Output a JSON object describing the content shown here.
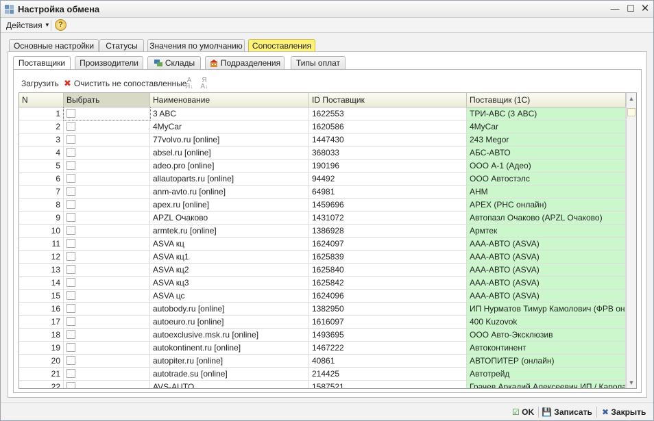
{
  "window": {
    "title": "Настройка обмена"
  },
  "menu": {
    "actions_label": "Действия",
    "help_label": "?"
  },
  "outer_tabs": [
    {
      "label": "Основные настройки"
    },
    {
      "label": "Статусы"
    },
    {
      "label": "Значения по умолчанию"
    },
    {
      "label": "Сопоставления",
      "active": true
    }
  ],
  "inner_tabs": [
    {
      "label": "Поставщики",
      "active": true
    },
    {
      "label": "Производители"
    },
    {
      "label": "Склады",
      "icon": "warehouse-icon"
    },
    {
      "label": "Подразделения",
      "icon": "building-icon"
    },
    {
      "label": "Типы оплат"
    }
  ],
  "toolbar": {
    "load_label": "Загрузить",
    "clear_label": "Очистить не сопоставленные",
    "sort_asc_icon": "sort-ascending-icon",
    "sort_desc_icon": "sort-descending-icon"
  },
  "grid": {
    "columns": [
      "N",
      "Выбрать",
      "Наименование",
      "ID Поставщик",
      "Поставщик (1С)"
    ],
    "rows": [
      {
        "n": "1",
        "name": "3 ABC",
        "id": "1622553",
        "supplier": "ТРИ-АВС (3 ABC)"
      },
      {
        "n": "2",
        "name": "4MyCar",
        "id": "1620586",
        "supplier": "4MyCar"
      },
      {
        "n": "3",
        "name": "77volvo.ru [online]",
        "id": "1447430",
        "supplier": "243 Megor"
      },
      {
        "n": "4",
        "name": "absel.ru [online]",
        "id": "368033",
        "supplier": "АБС-АВТО"
      },
      {
        "n": "5",
        "name": "adeo.pro [online]",
        "id": "190196",
        "supplier": "ООО А-1  (Адео)"
      },
      {
        "n": "6",
        "name": "allautoparts.ru [online]",
        "id": "94492",
        "supplier": "ООО Автостэлс"
      },
      {
        "n": "7",
        "name": "anm-avto.ru [online]",
        "id": "64981",
        "supplier": "АНМ"
      },
      {
        "n": "8",
        "name": "apex.ru [online]",
        "id": "1459696",
        "supplier": "APEX (РНС онлайн)"
      },
      {
        "n": "9",
        "name": "APZL Очаково",
        "id": "1431072",
        "supplier": "Автопазл Очаково (APZL Очаково)"
      },
      {
        "n": "10",
        "name": "armtek.ru [online]",
        "id": "1386928",
        "supplier": "Армтек"
      },
      {
        "n": "11",
        "name": "ASVA кц",
        "id": "1624097",
        "supplier": "ААА-АВТО (ASVA)"
      },
      {
        "n": "12",
        "name": "ASVA кц1",
        "id": "1625839",
        "supplier": "ААА-АВТО (ASVA)"
      },
      {
        "n": "13",
        "name": "ASVA кц2",
        "id": "1625840",
        "supplier": "ААА-АВТО (ASVA)"
      },
      {
        "n": "14",
        "name": "ASVA кц3",
        "id": "1625842",
        "supplier": "ААА-АВТО (ASVA)"
      },
      {
        "n": "15",
        "name": "ASVA цс",
        "id": "1624096",
        "supplier": "ААА-АВТО (ASVA)"
      },
      {
        "n": "16",
        "name": "autobody.ru [online]",
        "id": "1382950",
        "supplier": "ИП Нурматов Тимур Камолович (ФРВ онл..."
      },
      {
        "n": "17",
        "name": "autoeuro.ru [online]",
        "id": "1616097",
        "supplier": "400 Kuzovok"
      },
      {
        "n": "18",
        "name": "autoexclusive.msk.ru [online]",
        "id": "1493695",
        "supplier": "ООО Авто-Эксклюзив"
      },
      {
        "n": "19",
        "name": "autokontinent.ru [online]",
        "id": "1467222",
        "supplier": "Автоконтинент"
      },
      {
        "n": "20",
        "name": "autopiter.ru [online]",
        "id": "40861",
        "supplier": "АВТОПИТЕР (онлайн)"
      },
      {
        "n": "21",
        "name": "autotrade.su [online]",
        "id": "214425",
        "supplier": "Автотрейд"
      },
      {
        "n": "22",
        "name": "AVS-AUTO",
        "id": "1587521",
        "supplier": "Грачев Аркадий Алексеевич ИП / Карола..."
      }
    ]
  },
  "bottom": {
    "ok_label": "OK",
    "save_label": "Записать",
    "close_label": "Закрыть"
  },
  "colors": {
    "active_tab": "#fdf37a",
    "matched_cell": "#ccf7cc",
    "clear_icon": "#d9342b"
  }
}
